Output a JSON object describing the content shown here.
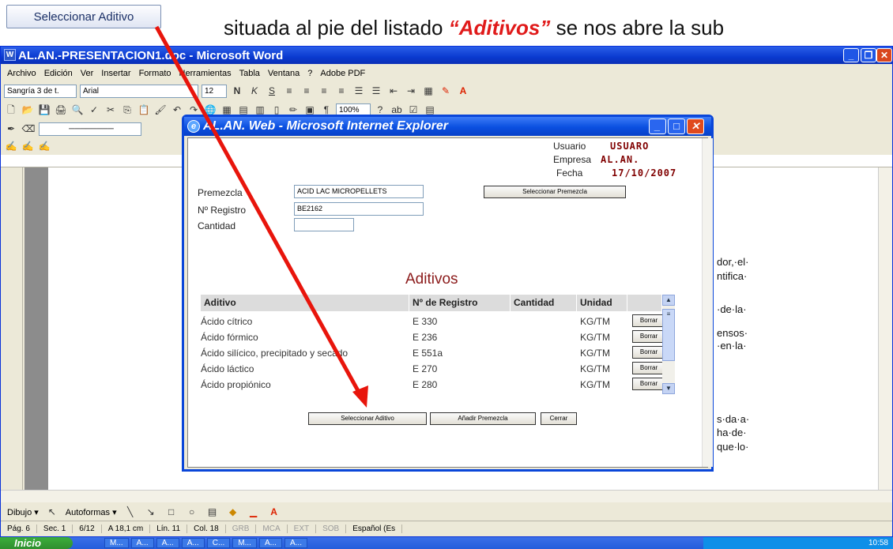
{
  "doc": {
    "callout_button": "Seleccionar Aditivo",
    "sentence_start": "situada al pie del listado",
    "sentence_highlight": "“Aditivos”",
    "sentence_end": "se nos abre la sub"
  },
  "word": {
    "title": "AL.AN.-PRESENTACION1.doc - Microsoft Word",
    "menu": [
      "Archivo",
      "Edición",
      "Ver",
      "Insertar",
      "Formato",
      "Herramientas",
      "Tabla",
      "Ventana",
      "?",
      "Adobe PDF"
    ],
    "style_combo": "Sangría 3 de t.",
    "font_combo": "Arial",
    "size_combo": "12",
    "zoom": "100%",
    "fragments": [
      "dor,·el·",
      "ntifica·",
      "·de·la·",
      "ensos·",
      "·en·la·",
      "s·da·a·",
      "ha·de·",
      "que·lo·"
    ],
    "drawing": {
      "dibujo": "Dibujo ▾",
      "autoformas": "Autoformas ▾"
    },
    "status": {
      "page": "Pág. 6",
      "section": "Sec. 1",
      "pages": "6/12",
      "at": "A 18,1 cm",
      "line": "Lín. 11",
      "col": "Col. 18",
      "grb": "GRB",
      "mca": "MCA",
      "ext": "EXT",
      "sob": "SOB",
      "lang": "Español (Es"
    }
  },
  "ie": {
    "title": "AL.AN. Web - Microsoft Internet Explorer",
    "usuario_label": "Usuario",
    "usuario_value": "USUARO",
    "empresa_label": "Empresa",
    "empresa_value": "AL.AN.",
    "fecha_label": "Fecha",
    "fecha_value": "17/10/2007",
    "premezcla_label": "Premezcla",
    "premezcla_value": "ACID LAC MICROPELLETS",
    "registro_label": "Nº Registro",
    "registro_value": "BE2162",
    "cantidad_label": "Cantidad",
    "cantidad_value": "",
    "select_premezcla_button": "Seleccionar Premezcla",
    "aditivos_title": "Aditivos",
    "columns": [
      "Aditivo",
      "Nº de Registro",
      "Cantidad",
      "Unidad"
    ],
    "rows": [
      {
        "aditivo": "Ácido cítrico",
        "registro": "E 330",
        "cantidad": "",
        "unidad": "KG/TM",
        "action": "Borrar"
      },
      {
        "aditivo": "Ácido fórmico",
        "registro": "E 236",
        "cantidad": "",
        "unidad": "KG/TM",
        "action": "Borrar"
      },
      {
        "aditivo": "Ácido silícico, precipitado y secado",
        "registro": "E 551a",
        "cantidad": "",
        "unidad": "KG/TM",
        "action": "Borrar"
      },
      {
        "aditivo": "Ácido láctico",
        "registro": "E 270",
        "cantidad": "",
        "unidad": "KG/TM",
        "action": "Borrar"
      },
      {
        "aditivo": "Ácido propiónico",
        "registro": "E 280",
        "cantidad": "",
        "unidad": "KG/TM",
        "action": "Borrar"
      }
    ],
    "buttons": {
      "select_aditivo": "Seleccionar Aditivo",
      "add_premezcla": "Añadir Premezcla",
      "close": "Cerrar"
    }
  },
  "taskbar": {
    "start": "Inicio",
    "tasks": [
      "M...",
      "A...",
      "A...",
      "A...",
      "C...",
      "M...",
      "A...",
      "A..."
    ],
    "clock": "10:58"
  },
  "colors": {
    "arrow": "#e8150c",
    "accent": "#800000"
  }
}
